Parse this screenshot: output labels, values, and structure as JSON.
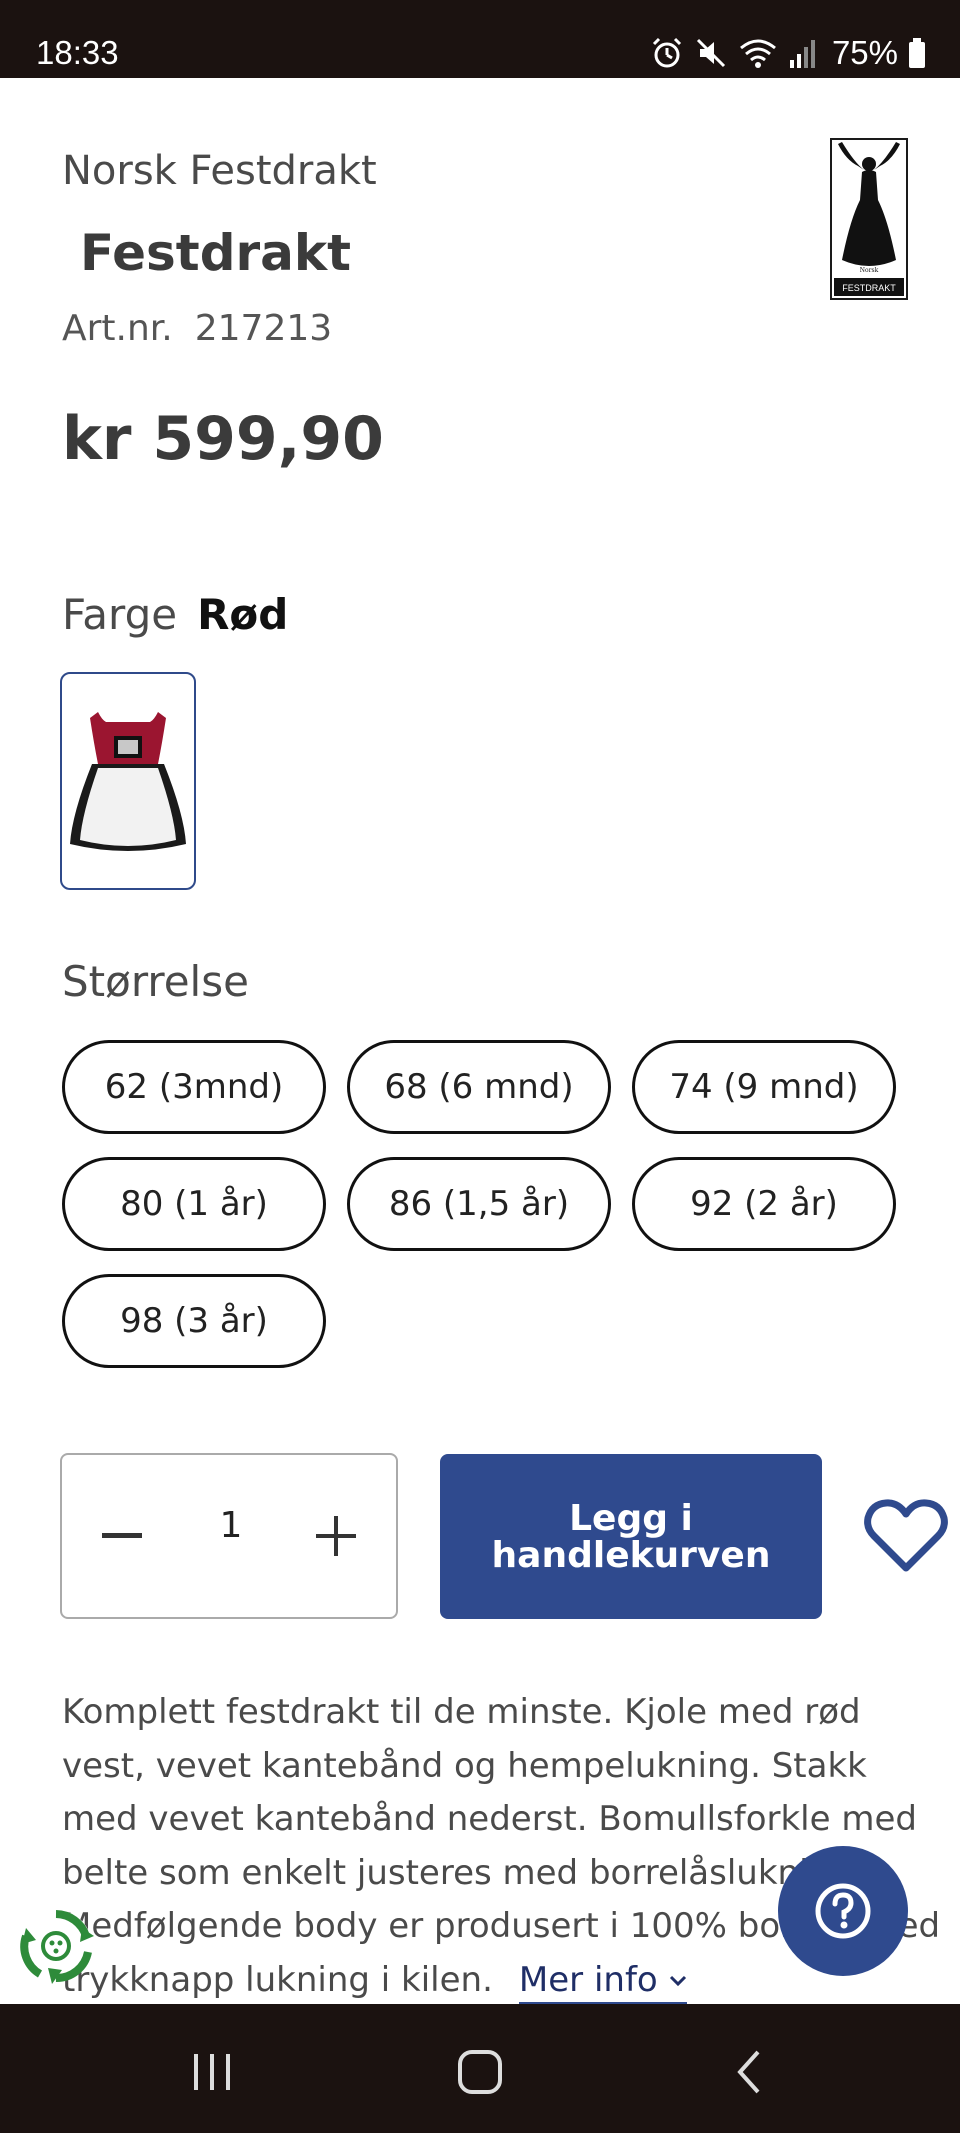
{
  "status_bar": {
    "time": "18:33",
    "battery": "75%",
    "icons": [
      "alarm-icon",
      "mute-icon",
      "wifi-icon",
      "signal-icon",
      "battery-icon"
    ]
  },
  "product": {
    "brand": "Norsk Festdrakt",
    "name": "Festdrakt",
    "artnr_label": "Art.nr.",
    "artnr_value": "217213",
    "price": "kr 599,90"
  },
  "color": {
    "label": "Farge",
    "selected": "Rød"
  },
  "size": {
    "label": "Størrelse",
    "options": [
      "62 (3mnd)",
      "68 (6 mnd)",
      "74 (9 mnd)",
      "80 (1 år)",
      "86 (1,5 år)",
      "92 (2 år)",
      "98 (3 år)"
    ]
  },
  "cart": {
    "quantity": "1",
    "add_label": "Legg i handlekurven"
  },
  "description": {
    "text": "Komplett festdrakt til de minste. Kjole med rød vest, vevet kantebånd og hempelukning. Stakk med vevet kantebånd nederst. Bomullsforkle med belte som enkelt justeres med borrelåslukning. Medfølgende body er produsert i 100% bomull med trykknapp lukning i kilen.",
    "more_label": "Mer info"
  },
  "colors": {
    "accent": "#2f4a8e",
    "system_bar": "#1b1210",
    "recycle_green": "#2e8b3a"
  }
}
